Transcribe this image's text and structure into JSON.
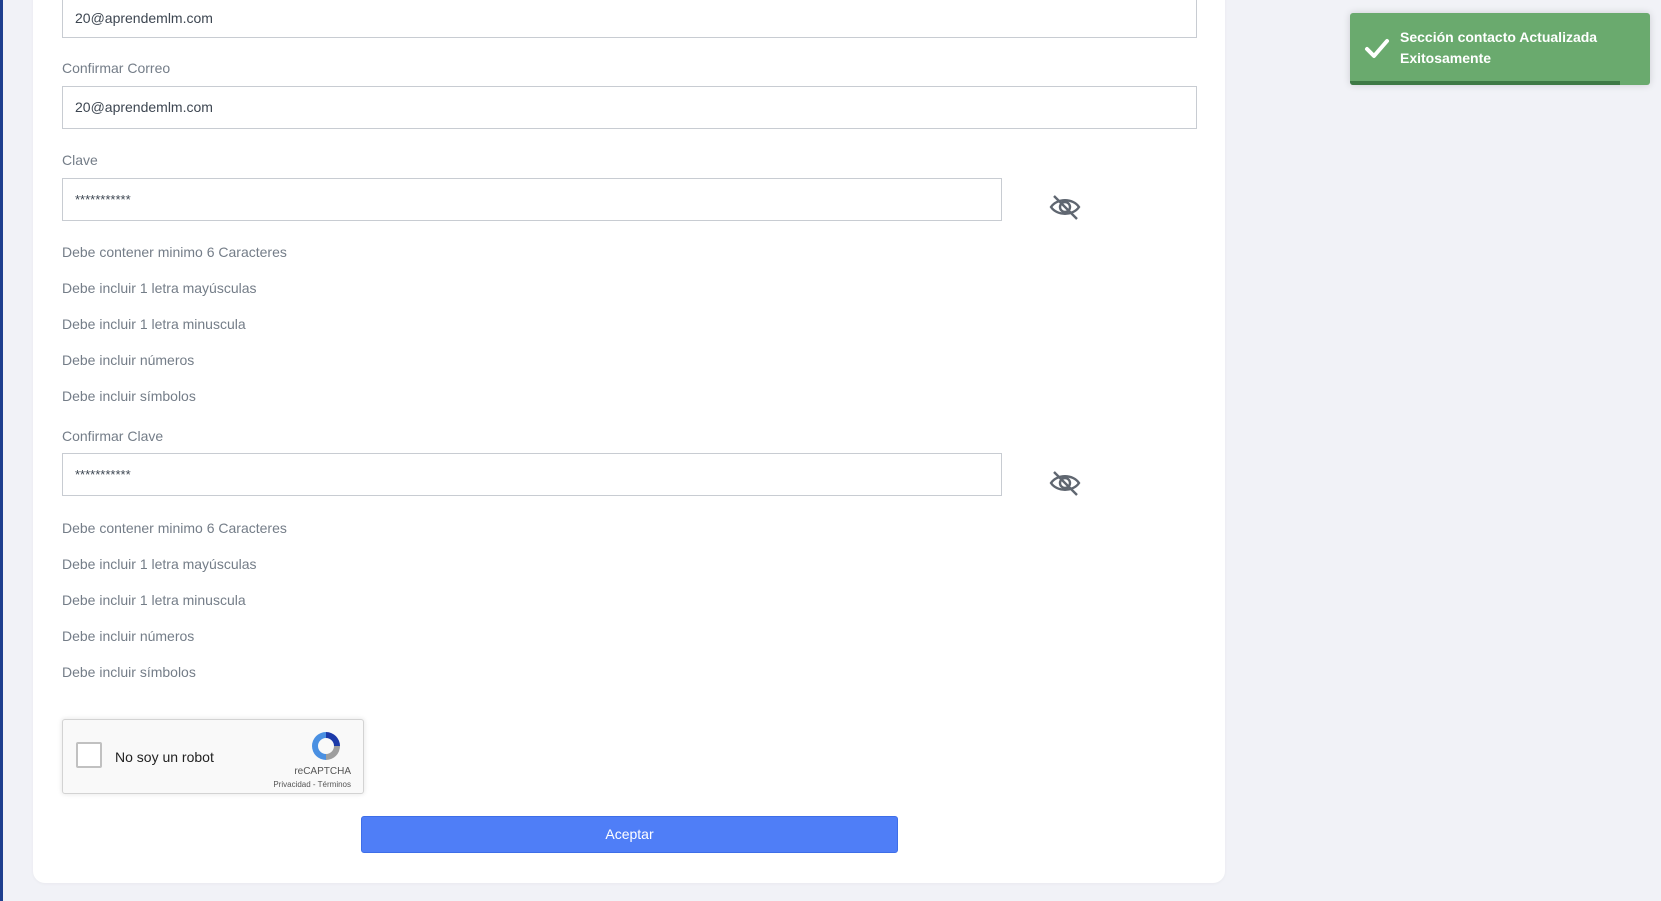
{
  "form": {
    "email_value": "20@aprendemlm.com",
    "confirm_email_label": "Confirmar Correo",
    "confirm_email_value": "20@aprendemlm.com",
    "password_label": "Clave",
    "password_value": "***********",
    "password_rules": [
      "Debe contener minimo 6 Caracteres",
      "Debe incluir 1 letra mayúsculas",
      "Debe incluir 1 letra minuscula",
      "Debe incluir números",
      "Debe incluir símbolos"
    ],
    "confirm_password_label": "Confirmar Clave",
    "confirm_password_value": "***********",
    "confirm_password_rules": [
      "Debe contener minimo 6 Caracteres",
      "Debe incluir 1 letra mayúsculas",
      "Debe incluir 1 letra minuscula",
      "Debe incluir números",
      "Debe incluir símbolos"
    ],
    "toggle_icon": "eye-slash-icon",
    "submit_label": "Aceptar"
  },
  "captcha": {
    "label": "No soy un robot",
    "brand": "reCAPTCHA",
    "links": "Privacidad - Términos",
    "checked": false
  },
  "toast": {
    "message": "Sección contacto Actualizada Exitosamente",
    "icon": "check-icon",
    "progress": 0.9,
    "color": "#6aaa6e"
  },
  "colors": {
    "accent": "#4f7ef7",
    "success": "#6aaa6e"
  }
}
